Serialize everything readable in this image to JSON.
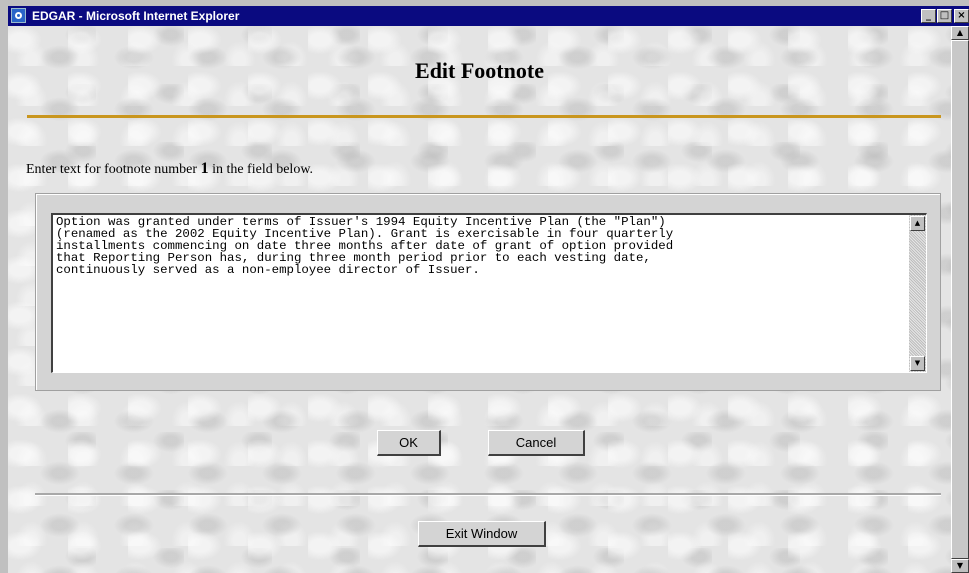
{
  "window": {
    "title": "EDGAR - Microsoft Internet Explorer",
    "minimize_glyph": "_",
    "maximize_glyph": "□",
    "close_glyph": "×"
  },
  "page": {
    "heading": "Edit Footnote",
    "instruction_prefix": "Enter text for footnote number ",
    "footnote_number": "1",
    "instruction_suffix": " in the field below."
  },
  "footnote": {
    "text": "Option was granted under terms of Issuer's 1994 Equity Incentive Plan (the \"Plan\")\n(renamed as the 2002 Equity Incentive Plan). Grant is exercisable in four quarterly\ninstallments commencing on date three months after date of grant of option provided\nthat Reporting Person has, during three month period prior to each vesting date,\ncontinuously served as a non-employee director of Issuer."
  },
  "buttons": {
    "ok": "OK",
    "cancel": "Cancel",
    "exit": "Exit Window"
  },
  "colors": {
    "accent_rule": "#c9961e",
    "titlebar": "#0a0a80"
  }
}
